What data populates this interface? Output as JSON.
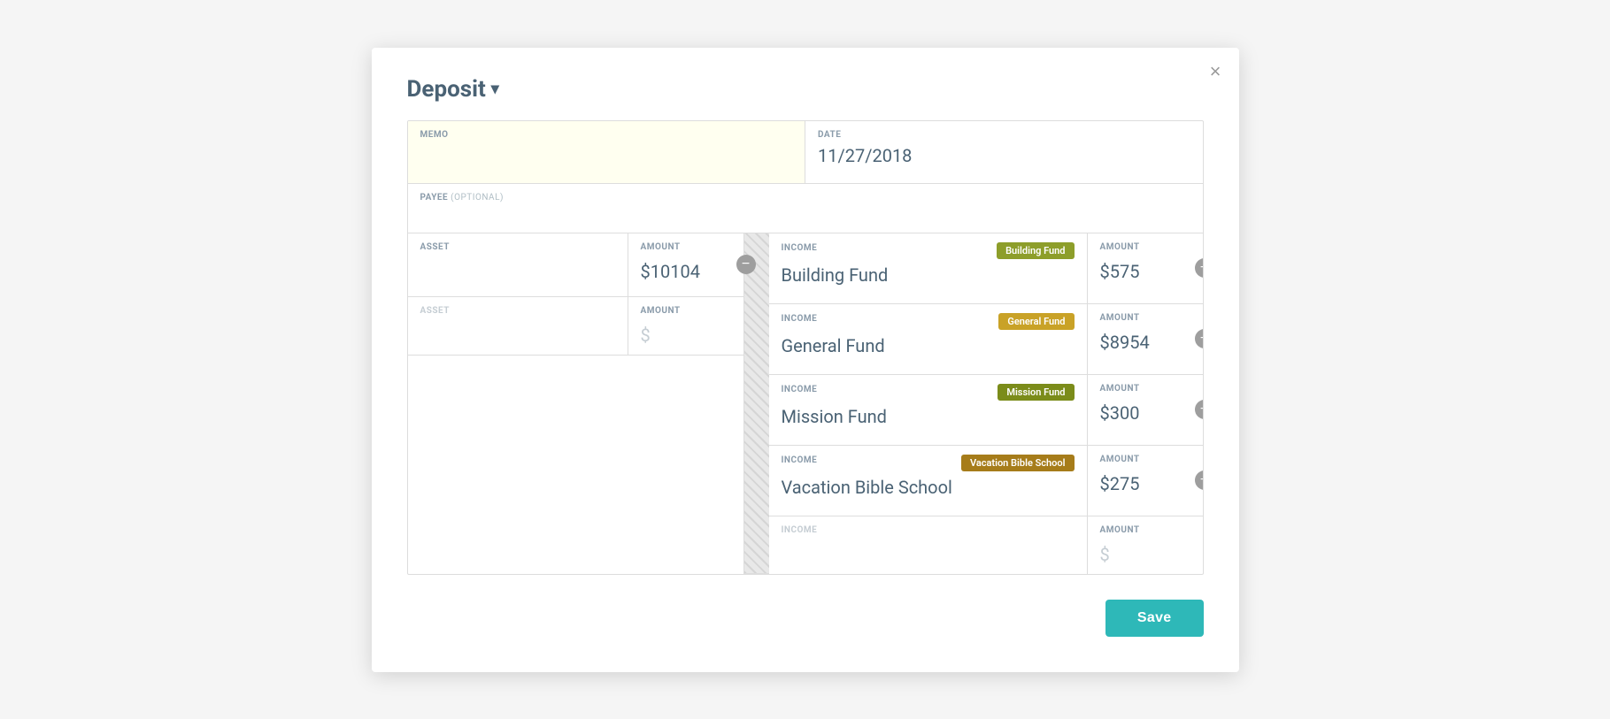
{
  "modal": {
    "title": "Deposit",
    "chevron": "▾",
    "close_label": "×"
  },
  "form": {
    "memo_label": "MEMO",
    "memo_value": "",
    "date_label": "DATE",
    "date_value": "11/27/2018",
    "payee_label": "PAYEE",
    "payee_optional": "(OPTIONAL)",
    "asset_label": "ASSET",
    "amount_label": "AMOUNT",
    "income_label": "INCOME"
  },
  "assets": [
    {
      "asset": "",
      "amount": "$10104",
      "placeholder": false
    },
    {
      "asset": "",
      "amount": "$",
      "placeholder": true
    }
  ],
  "income_items": [
    {
      "label": "INCOME",
      "tag": "Building Fund",
      "tag_class": "tag-building",
      "name": "Building Fund",
      "amount_label": "AMOUNT",
      "amount": "$575",
      "placeholder": false
    },
    {
      "label": "INCOME",
      "tag": "General Fund",
      "tag_class": "tag-general",
      "name": "General Fund",
      "amount_label": "AMOUNT",
      "amount": "$8954",
      "placeholder": false
    },
    {
      "label": "INCOME",
      "tag": "Mission Fund",
      "tag_class": "tag-mission",
      "name": "Mission Fund",
      "amount_label": "AMOUNT",
      "amount": "$300",
      "placeholder": false
    },
    {
      "label": "INCOME",
      "tag": "Vacation Bible School",
      "tag_class": "tag-vbs",
      "name": "Vacation Bible School",
      "amount_label": "AMOUNT",
      "amount": "$275",
      "placeholder": false
    },
    {
      "label": "INCOME",
      "tag": "",
      "tag_class": "",
      "name": "",
      "amount_label": "AMOUNT",
      "amount": "$",
      "placeholder": true
    }
  ],
  "footer": {
    "save_label": "Save"
  }
}
